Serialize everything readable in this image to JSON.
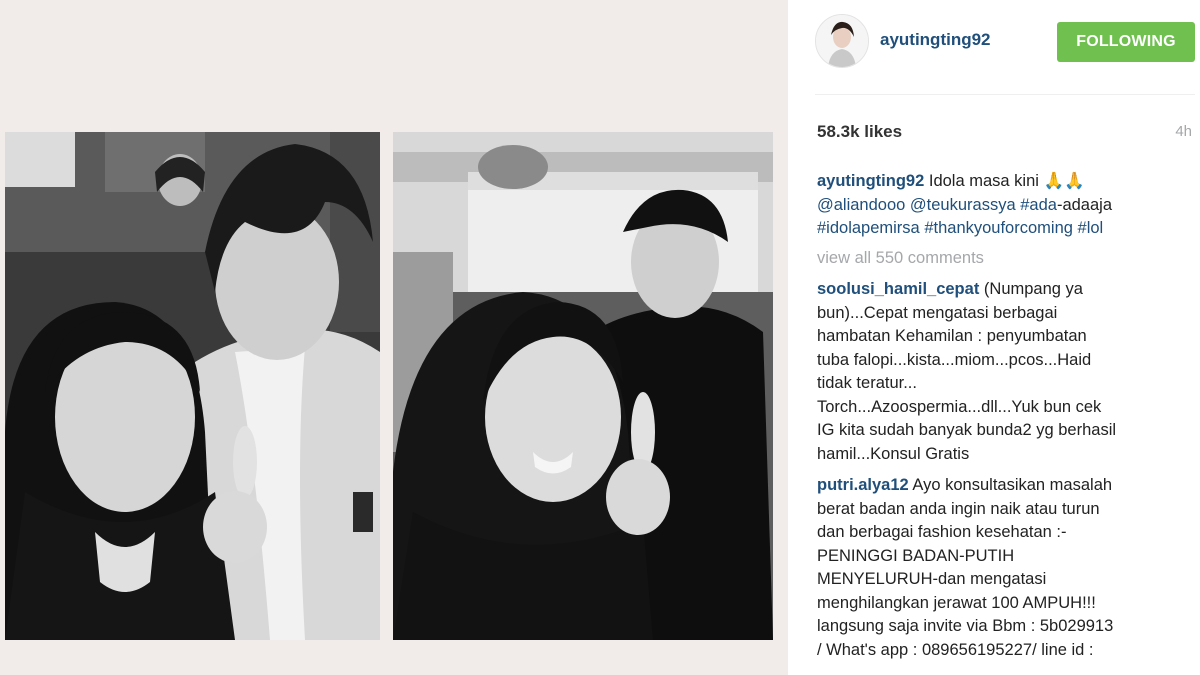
{
  "post": {
    "username": "ayutingting92",
    "follow_label": "FOLLOWING",
    "likes": "58.3k likes",
    "time": "4h",
    "caption": {
      "text": "Idola masa kini 🙏🙏",
      "mentions": [
        "@aliandooo",
        "@teukurassya"
      ],
      "hashtag_line1": "#ada",
      "hashtag_line1_rest": "-adaaja",
      "hashtags": [
        "#idolapemirsa",
        "#thankyouforcoming",
        "#lol"
      ]
    },
    "view_all_comments": "view all 550 comments",
    "comments": [
      {
        "user": "soolusi_hamil_cepat",
        "lines": [
          "(Numpang ya",
          "bun)...Cepat mengatasi berbagai",
          "hambatan Kehamilan : penyumbatan",
          "tuba falopi...kista...miom...pcos...Haid",
          "tidak teratur...",
          "Torch...Azoospermia...dll...Yuk bun cek",
          "IG kita sudah banyak bunda2 yg berhasil",
          "hamil...Konsul Gratis"
        ]
      },
      {
        "user": "putri.alya12",
        "lines": [
          "Ayo konsultasikan masalah",
          "berat badan anda ingin naik atau turun",
          "dan berbagai fashion kesehatan :-",
          "PENINGGI BADAN-PUTIH",
          "MENYELURUH-dan mengatasi",
          "menghilangkan jerawat 100 AMPUH!!!",
          "langsung saja invite via Bbm : 5b029913",
          "/ What's app : 089656195227/ line id :"
        ]
      }
    ]
  },
  "colors": {
    "follow_button": "#70c050",
    "username": "#1f4f7a",
    "muted": "#a5a7aa",
    "image_background": "#f1ebea"
  },
  "icons": {
    "avatar": "profile-avatar",
    "left_photo": "selfie-photo-left",
    "right_photo": "selfie-photo-right"
  }
}
